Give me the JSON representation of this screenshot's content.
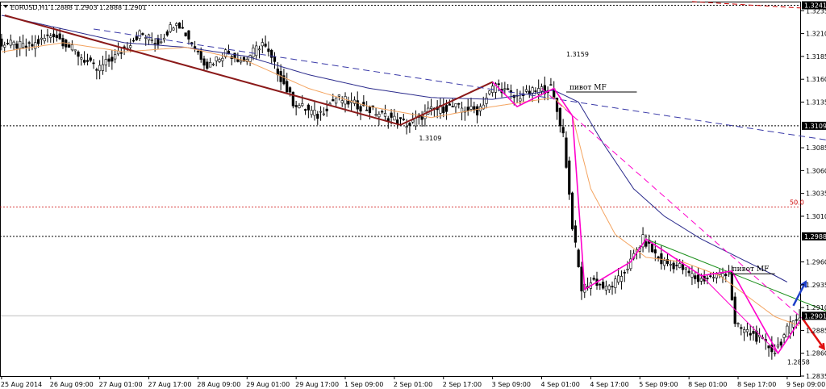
{
  "header": {
    "symbol": "EURUSD,H1",
    "ohlc": "1.2888 1.2903 1.2888 1.2901"
  },
  "colors": {
    "candle": "#000000",
    "ma_fast": "#f4a460",
    "ma_slow": "#2b2b8c",
    "trend_brown": "#8b1a1a",
    "trend_blue_dashed": "#3a3aa8",
    "trend_green": "#1a8f1a",
    "zigzag_magenta": "#ff00cc",
    "level_black": "#000000",
    "level_red": "#cc0000",
    "arrow_up": "#1e3fc8",
    "arrow_down": "#e01010",
    "highlight_price": "#000000"
  },
  "chart_data": {
    "type": "line",
    "title": "",
    "xlabel": "",
    "ylabel": "",
    "ylim": [
      1.2835,
      1.3245
    ],
    "price_ticks": [
      "1.3235",
      "1.3210",
      "1.3185",
      "1.3160",
      "1.3135",
      "1.3085",
      "1.3060",
      "1.3035",
      "1.3010",
      "1.2960",
      "1.2935",
      "1.2910",
      "1.2885",
      "1.2860",
      "1.2835"
    ],
    "price_tick_values": [
      1.3235,
      1.321,
      1.3185,
      1.316,
      1.3135,
      1.3085,
      1.306,
      1.3035,
      1.301,
      1.296,
      1.2935,
      1.291,
      1.2885,
      1.286,
      1.2835
    ],
    "time_ticks": [
      "25 Aug 2014",
      "26 Aug 09:00",
      "27 Aug 01:00",
      "27 Aug 17:00",
      "28 Aug 09:00",
      "29 Aug 01:00",
      "29 Aug 17:00",
      "1 Sep 09:00",
      "2 Sep 01:00",
      "2 Sep 17:00",
      "3 Sep 09:00",
      "4 Sep 01:00",
      "4 Sep 17:00",
      "5 Sep 09:00",
      "8 Sep 01:00",
      "8 Sep 17:00",
      "9 Sep 09:00"
    ],
    "time_tick_index": [
      0,
      16,
      32,
      48,
      64,
      80,
      96,
      112,
      128,
      144,
      160,
      176,
      192,
      208,
      224,
      240,
      256
    ],
    "candles_n": 261,
    "price_anchors": [
      [
        0,
        1.32
      ],
      [
        10,
        1.3195
      ],
      [
        18,
        1.321
      ],
      [
        25,
        1.319
      ],
      [
        32,
        1.317
      ],
      [
        38,
        1.3185
      ],
      [
        46,
        1.321
      ],
      [
        52,
        1.32
      ],
      [
        58,
        1.3225
      ],
      [
        62,
        1.3205
      ],
      [
        68,
        1.3175
      ],
      [
        74,
        1.319
      ],
      [
        80,
        1.318
      ],
      [
        86,
        1.32
      ],
      [
        90,
        1.3175
      ],
      [
        96,
        1.3135
      ],
      [
        104,
        1.312
      ],
      [
        110,
        1.314
      ],
      [
        118,
        1.313
      ],
      [
        126,
        1.312
      ],
      [
        134,
        1.311
      ],
      [
        140,
        1.3125
      ],
      [
        148,
        1.313
      ],
      [
        156,
        1.3125
      ],
      [
        162,
        1.3155
      ],
      [
        168,
        1.314
      ],
      [
        176,
        1.3148
      ],
      [
        180,
        1.315
      ],
      [
        184,
        1.31
      ],
      [
        187,
        1.3
      ],
      [
        190,
        1.293
      ],
      [
        194,
        1.294
      ],
      [
        198,
        1.293
      ],
      [
        202,
        1.294
      ],
      [
        206,
        1.296
      ],
      [
        210,
        1.2985
      ],
      [
        216,
        1.296
      ],
      [
        222,
        1.2955
      ],
      [
        228,
        1.294
      ],
      [
        234,
        1.2945
      ],
      [
        238,
        1.295
      ],
      [
        240,
        1.289
      ],
      [
        246,
        1.288
      ],
      [
        250,
        1.287
      ],
      [
        253,
        1.2862
      ],
      [
        257,
        1.2885
      ],
      [
        260,
        1.2901
      ]
    ],
    "ma_fast_anchors": [
      [
        0,
        1.319
      ],
      [
        20,
        1.32
      ],
      [
        40,
        1.319
      ],
      [
        60,
        1.3195
      ],
      [
        80,
        1.318
      ],
      [
        100,
        1.315
      ],
      [
        120,
        1.313
      ],
      [
        140,
        1.3118
      ],
      [
        160,
        1.313
      ],
      [
        180,
        1.314
      ],
      [
        186,
        1.312
      ],
      [
        192,
        1.304
      ],
      [
        200,
        1.299
      ],
      [
        210,
        1.2965
      ],
      [
        222,
        1.296
      ],
      [
        234,
        1.2945
      ],
      [
        244,
        1.292
      ],
      [
        252,
        1.29
      ],
      [
        260,
        1.289
      ]
    ],
    "ma_slow_anchors": [
      [
        0,
        1.323
      ],
      [
        20,
        1.3215
      ],
      [
        40,
        1.32
      ],
      [
        60,
        1.3195
      ],
      [
        80,
        1.3185
      ],
      [
        100,
        1.3165
      ],
      [
        120,
        1.315
      ],
      [
        140,
        1.314
      ],
      [
        160,
        1.3138
      ],
      [
        180,
        1.3148
      ],
      [
        188,
        1.3135
      ],
      [
        196,
        1.309
      ],
      [
        206,
        1.304
      ],
      [
        216,
        1.301
      ],
      [
        228,
        1.2985
      ],
      [
        240,
        1.2965
      ],
      [
        252,
        1.2945
      ],
      [
        256,
        1.2938
      ]
    ],
    "zigzag": [
      [
        1,
        1.323
      ],
      [
        130,
        1.311
      ],
      [
        160,
        1.3157
      ],
      [
        168,
        1.313
      ],
      [
        180,
        1.315
      ],
      [
        186,
        1.312
      ],
      [
        190,
        1.293
      ],
      [
        205,
        1.296
      ],
      [
        210,
        1.2985
      ],
      [
        228,
        1.2945
      ],
      [
        238,
        1.295
      ],
      [
        253,
        1.286
      ],
      [
        260,
        1.2895
      ]
    ],
    "trendlines": [
      {
        "id": "brown-downtrend",
        "color": "trend_brown",
        "dash": false,
        "points": [
          [
            1,
            1.323
          ],
          [
            130,
            1.311
          ]
        ]
      },
      {
        "id": "brown-up-leg",
        "color": "trend_brown",
        "dash": false,
        "points": [
          [
            130,
            1.311
          ],
          [
            160,
            1.3157
          ]
        ]
      },
      {
        "id": "blue-dashed-resistance",
        "color": "trend_blue_dashed",
        "dash": true,
        "points": [
          [
            30,
            1.3215
          ],
          [
            325,
            1.3065
          ]
        ]
      },
      {
        "id": "green-trend",
        "color": "trend_green",
        "dash": false,
        "points": [
          [
            210,
            1.2985
          ],
          [
            298,
            1.2867
          ]
        ]
      },
      {
        "id": "magenta-channel-upper",
        "color": "zigzag_magenta",
        "dash": true,
        "points": [
          [
            176,
            1.315
          ],
          [
            262,
            1.2895
          ]
        ]
      },
      {
        "id": "magenta-channel-lower",
        "color": "zigzag_magenta",
        "dash": false,
        "points": [
          [
            228,
            1.2945
          ],
          [
            253,
            1.286
          ]
        ]
      }
    ],
    "horizontal_levels": [
      {
        "id": "level-1.3241",
        "value": 1.3241,
        "label": "1.3241",
        "color": "level_black",
        "dash": true
      },
      {
        "id": "level-1.3109",
        "value": 1.3109,
        "label": "1.3109",
        "color": "level_black",
        "dash": true
      },
      {
        "id": "level-1.2988",
        "value": 1.2988,
        "label": "1.2988",
        "color": "level_black",
        "dash": true
      },
      {
        "id": "level-1.2901",
        "value": 1.2901,
        "label": "1.2901",
        "color": "level_black",
        "dash": false,
        "highlight": true
      }
    ],
    "fib_level": {
      "value": 1.302,
      "label": "50.0"
    },
    "pivot_segments": [
      {
        "label": "пивот MF",
        "value": 1.3146,
        "x1": 184,
        "x2": 207
      },
      {
        "label": "пивот MF",
        "value": 1.2947,
        "x1": 237,
        "x2": 252
      }
    ],
    "price_labels": [
      {
        "text": "1.3159",
        "x": 184,
        "y": 1.3185
      },
      {
        "text": "1.3109",
        "x": 136,
        "y": 1.3093
      },
      {
        "text": "1.2858",
        "x": 256,
        "y": 1.2848
      }
    ],
    "arrows": [
      {
        "id": "up-arrow",
        "color": "arrow_up",
        "from": [
          258,
          1.2912
        ],
        "to": [
          262,
          1.2938
        ]
      },
      {
        "id": "down-arrow",
        "color": "arrow_down",
        "from": [
          261,
          1.2898
        ],
        "to": [
          268,
          1.2865
        ]
      }
    ]
  }
}
